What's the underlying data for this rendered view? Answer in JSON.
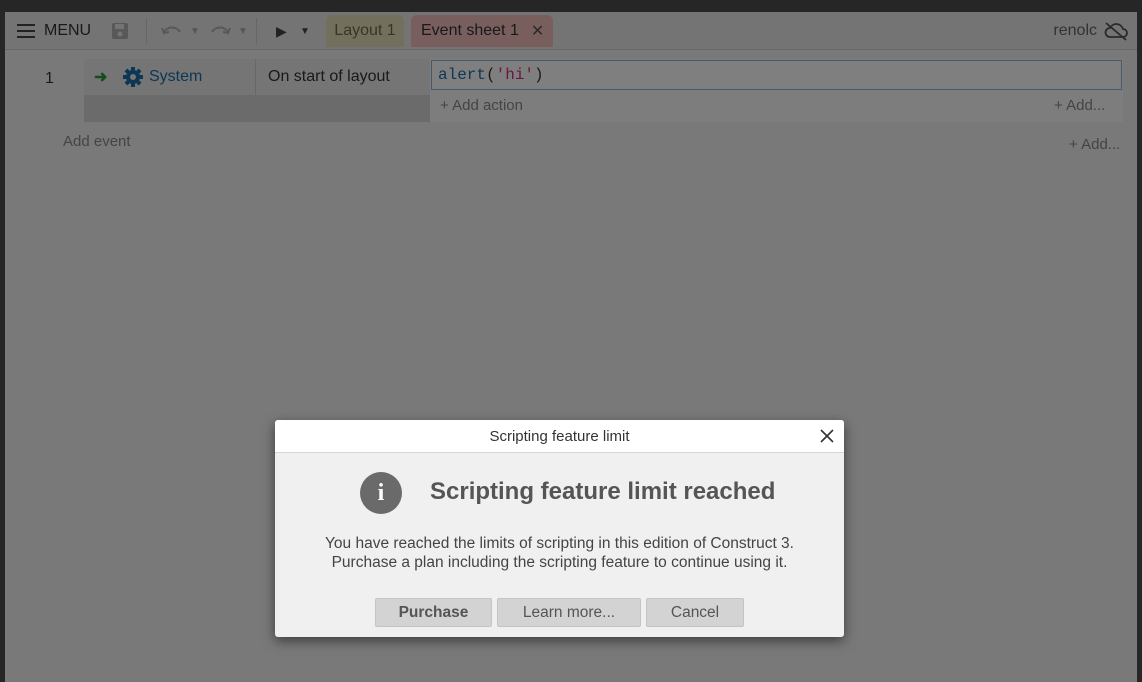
{
  "menu": {
    "label": "MENU"
  },
  "tabs": [
    {
      "label": "Layout 1"
    },
    {
      "label": "Event sheet 1"
    }
  ],
  "user": {
    "name": "renolc"
  },
  "event": {
    "number": "1",
    "object": "System",
    "condition": "On start of layout",
    "action_code": {
      "func": "alert",
      "open": "(",
      "arg": "'hi'",
      "close": ")"
    },
    "add_action": "Add action",
    "add_more": "Add...",
    "add_event": "Add event"
  },
  "dialog": {
    "title": "Scripting feature limit",
    "heading": "Scripting feature limit reached",
    "message_line1": "You have reached the limits of scripting in this edition of Construct 3.",
    "message_line2": "Purchase a plan including the scripting feature to continue using it.",
    "buttons": {
      "purchase": "Purchase",
      "learn_more": "Learn more...",
      "cancel": "Cancel"
    }
  },
  "colors": {
    "layout_tab": "#e5e0b8",
    "event_tab": "#f2bcbc",
    "object_blue": "#1b6fa8",
    "string_pink": "#d42a86"
  }
}
